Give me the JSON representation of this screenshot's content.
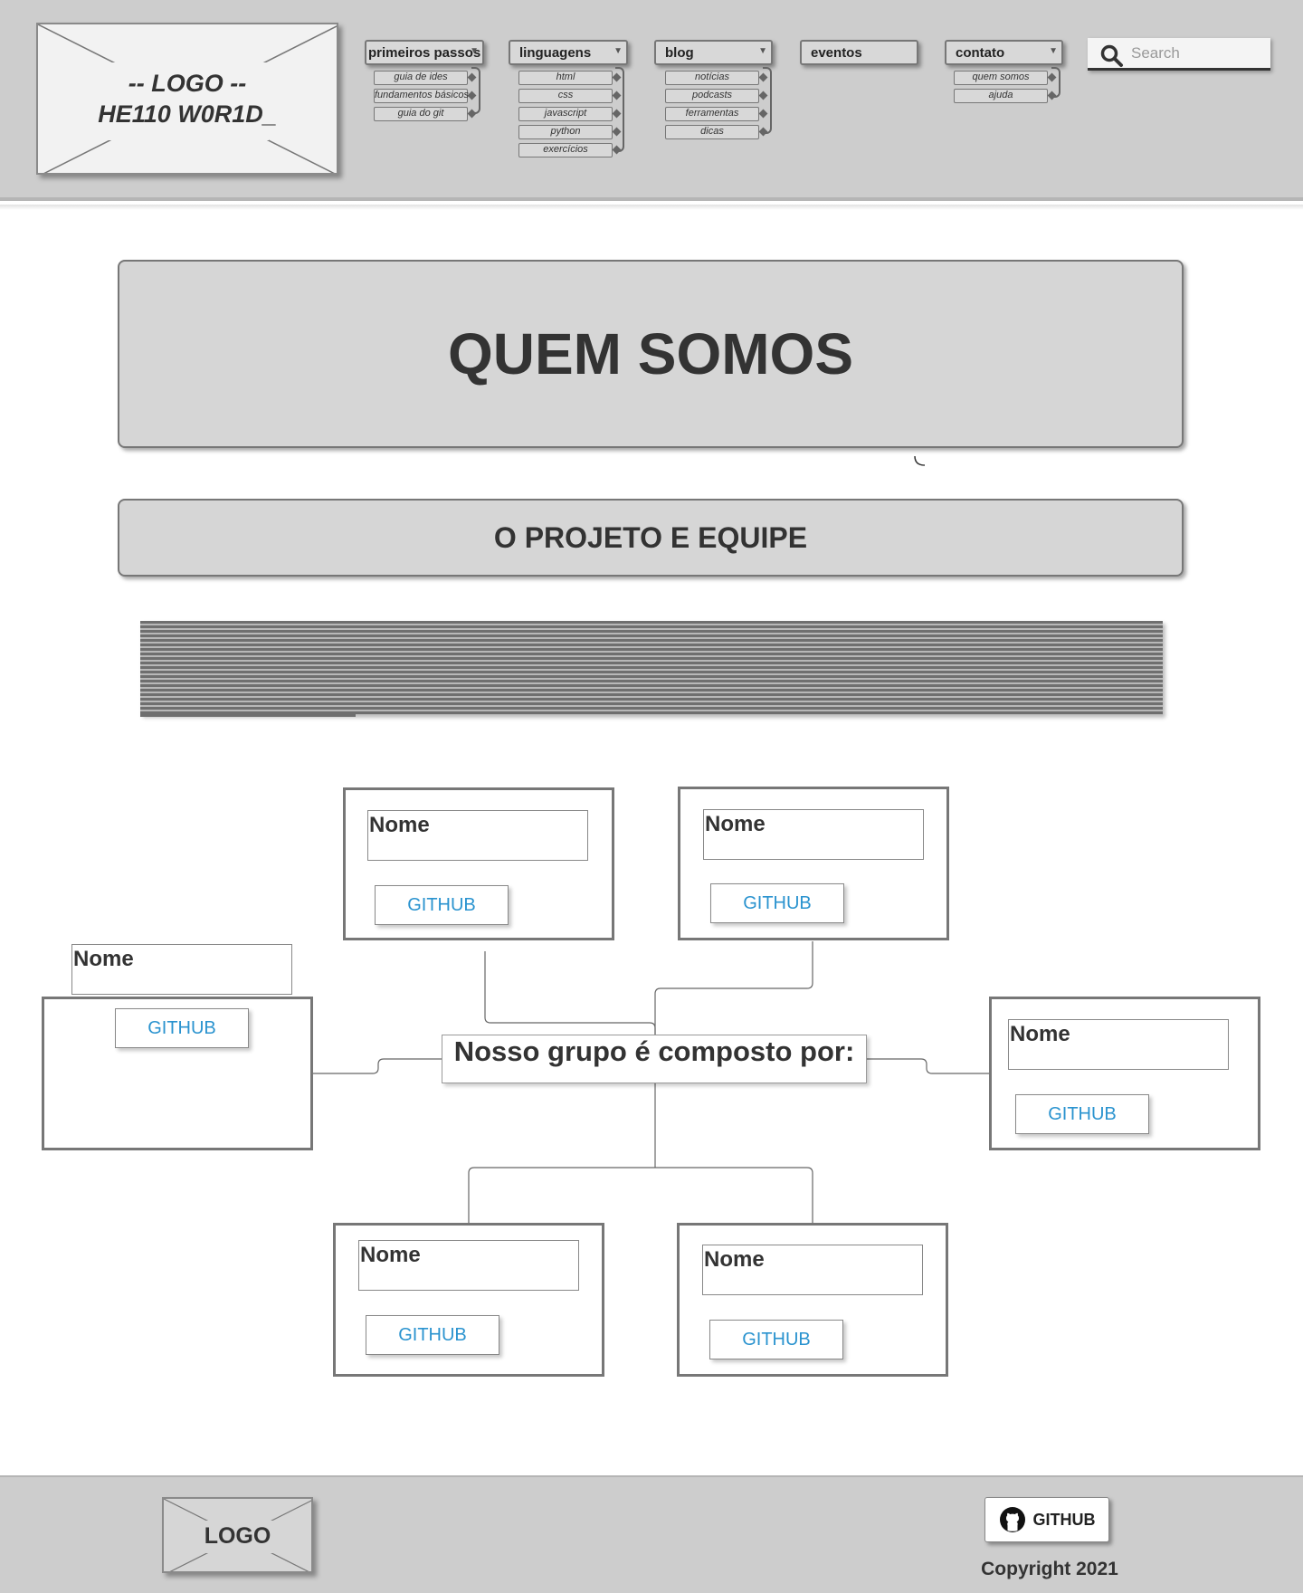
{
  "header": {
    "logo_line1": "-- LOGO --",
    "logo_line2": "HE110 W0R1D_",
    "search_placeholder": "Search",
    "menus": [
      {
        "label": "primeiros passos",
        "items": [
          "guia de ides",
          "fundamentos básicos",
          "guia do git"
        ]
      },
      {
        "label": "linguagens",
        "items": [
          "html",
          "css",
          "javascript",
          "python",
          "exercícios"
        ]
      },
      {
        "label": "blog",
        "items": [
          "notícias",
          "podcasts",
          "ferramentas",
          "dicas"
        ]
      },
      {
        "label": "eventos",
        "items": []
      },
      {
        "label": "contato",
        "items": [
          "quem somos",
          "ajuda"
        ]
      }
    ]
  },
  "hero": {
    "title": "QUEM SOMOS"
  },
  "section": {
    "title": "O PROJETO E EQUIPE"
  },
  "team": {
    "center_label": "Nosso grupo é composto por:",
    "members": [
      {
        "name": "Nome",
        "github": "GITHUB"
      },
      {
        "name": "Nome",
        "github": "GITHUB"
      },
      {
        "name": "Nome",
        "github": "GITHUB"
      },
      {
        "name": "Nome",
        "github": "GITHUB"
      },
      {
        "name": "Nome",
        "github": "GITHUB"
      },
      {
        "name": "Nome",
        "github": "GITHUB"
      }
    ]
  },
  "footer": {
    "logo": "LOGO",
    "github_label": "GITHUB",
    "copyright": "Copyright 2021"
  }
}
